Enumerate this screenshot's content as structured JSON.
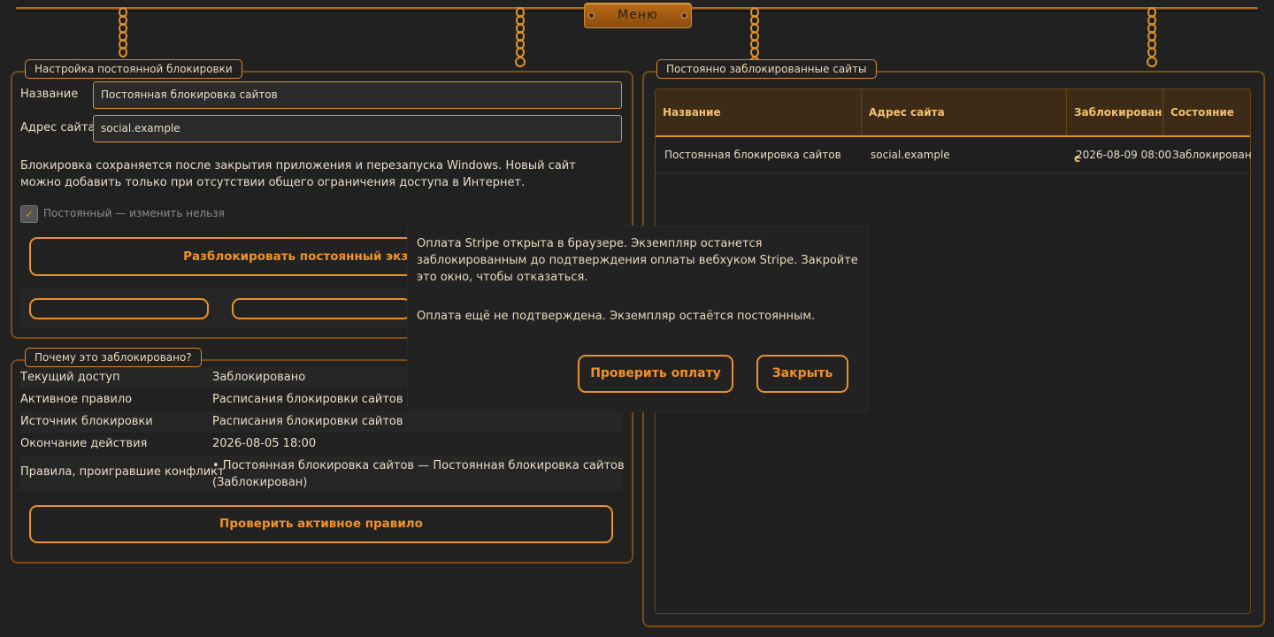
{
  "menu": {
    "label": "Меню"
  },
  "settings": {
    "legend": "Настройка постоянной блокировки",
    "name_label": "Название",
    "name_value": "Постоянная блокировка сайтов",
    "address_label": "Адрес сайта",
    "address_value": "social.example",
    "description": "Блокировка сохраняется после закрытия приложения и перезапуска Windows. Новый сайт можно добавить только при отсутствии общего ограничения доступа в Интернет.",
    "checkbox_label": "Постоянный — изменить нельзя",
    "checkbox_checked": true,
    "unlock_button": "Разблокировать постоянный экземпляр"
  },
  "why": {
    "legend": "Почему это заблокировано?",
    "rows": [
      {
        "key": "Текущий доступ",
        "value": "Заблокировано"
      },
      {
        "key": "Активное правило",
        "value": "Расписания блокировки сайтов"
      },
      {
        "key": "Источник блокировки",
        "value": "Расписания блокировки сайтов"
      },
      {
        "key": "Окончание действия",
        "value": "2026-08-05 18:00"
      },
      {
        "key": "Правила, проигравшие конфликт",
        "value_line1": "• Постоянная блокировка сайтов — Постоянная блокировка сайтов",
        "value_line2": "(Заблокирован)"
      }
    ],
    "check_button": "Проверить активное правило"
  },
  "blocked": {
    "legend": "Постоянно заблокированные сайты",
    "columns": [
      "Название",
      "Адрес сайта",
      "Заблокирован с",
      "Состояние"
    ],
    "rows": [
      {
        "name": "Постоянная блокировка сайтов",
        "address": "social.example",
        "since": "2026-08-09 08:00",
        "state": "Заблокирован"
      }
    ]
  },
  "dialog": {
    "message": "Оплата Stripe открыта в браузере. Экземпляр останется заблокированным до подтверждения оплаты вебхуком Stripe. Закройте это окно, чтобы отказаться.",
    "status": "Оплата ещё не подтверждена. Экземпляр остаётся постоянным.",
    "check_button": "Проверить оплату",
    "close_button": "Закрыть"
  },
  "colors": {
    "accent": "#e8922a",
    "background": "#212121",
    "panel_border": "#7a4d15"
  }
}
